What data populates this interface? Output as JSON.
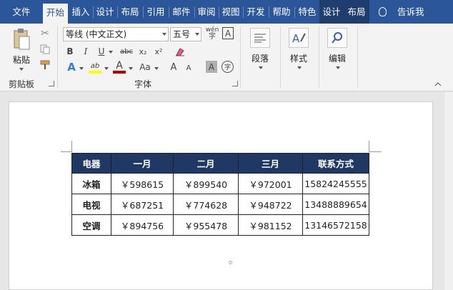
{
  "tabs": [
    "文件",
    "开始",
    "插入",
    "设计",
    "布局",
    "引用",
    "邮件",
    "审阅",
    "视图",
    "开发",
    "帮助",
    "特色",
    "设计",
    "布局"
  ],
  "tell_me": "告诉我",
  "clipboard": {
    "paste": "粘贴",
    "group": "剪贴板"
  },
  "font": {
    "name": "等线 (中文正文)",
    "size": "五号",
    "group": "字体",
    "bold": "B",
    "italic": "I",
    "underline": "U",
    "strike": "abc",
    "sub": "x₂",
    "sup": "x²",
    "grow": "A",
    "shrink": "A",
    "case": "Aa",
    "phonetic": "wén",
    "border_char": "A",
    "shade_char": "A",
    "enclose": "字",
    "highlight": "ab",
    "font_color": "A"
  },
  "groups": {
    "paragraph": "段落",
    "styles": "样式",
    "editing": "编辑"
  },
  "colors": {
    "tabbar": "#2b579a",
    "header": "#1f3864",
    "highlight": "#ffff00",
    "font_color": "#c00000"
  },
  "table": {
    "headers": [
      "电器",
      "一月",
      "二月",
      "三月",
      "联系方式"
    ],
    "rows": [
      [
        "冰箱",
        "￥598615",
        "￥899540",
        "￥972001",
        "15824245555"
      ],
      [
        "电视",
        "￥687251",
        "￥774628",
        "￥948722",
        "13488889654"
      ],
      [
        "空调",
        "￥894756",
        "￥955478",
        "￥981152",
        "13146572158"
      ]
    ]
  }
}
